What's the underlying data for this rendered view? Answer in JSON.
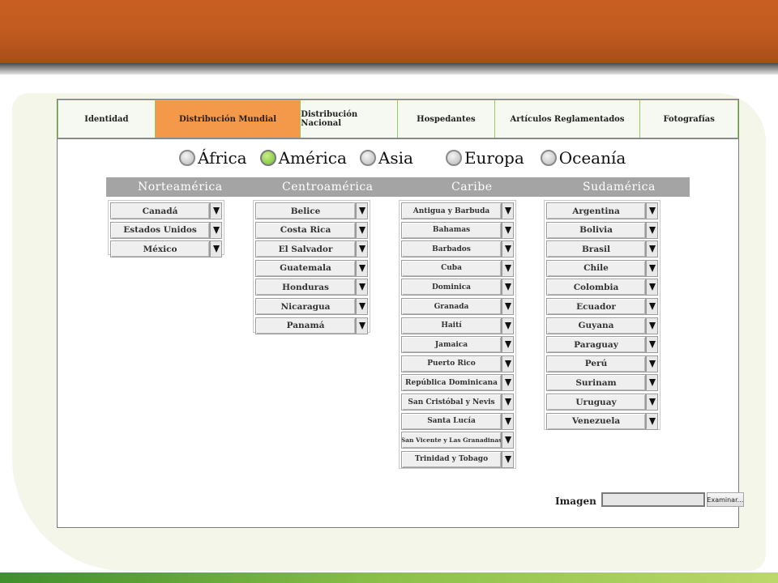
{
  "tabs": [
    {
      "label": "Identidad",
      "active": false
    },
    {
      "label": "Distribución Mundial",
      "active": true
    },
    {
      "label": "Distribución Nacional",
      "active": false
    },
    {
      "label": "Hospedantes",
      "active": false
    },
    {
      "label": "Artículos Reglamentados",
      "active": false
    },
    {
      "label": "Fotografías",
      "active": false
    }
  ],
  "regions": [
    {
      "label": "África",
      "selected": false
    },
    {
      "label": "América",
      "selected": true
    },
    {
      "label": "Asia",
      "selected": false
    },
    {
      "label": "Europa",
      "selected": false
    },
    {
      "label": "Oceanía",
      "selected": false
    }
  ],
  "subregions": [
    "Norteamérica",
    "Centroamérica",
    "Caribe",
    "Sudamérica"
  ],
  "norteamerica": [
    "Canadá",
    "Estados Unidos",
    "México"
  ],
  "centroamerica": [
    "Belice",
    "Costa Rica",
    "El Salvador",
    "Guatemala",
    "Honduras",
    "Nicaragua",
    "Panamá"
  ],
  "caribe": [
    "Antigua y Barbuda",
    "Bahamas",
    "Barbados",
    "Cuba",
    "Dominica",
    "Granada",
    "Haití",
    "Jamaica",
    "Puerto Rico",
    "República Dominicana",
    "San Cristóbal y Nevis",
    "Santa Lucía",
    "San Vicente y Las Granadinas",
    "Trinidad y Tobago"
  ],
  "sudamerica": [
    "Argentina",
    "Bolivia",
    "Brasil",
    "Chile",
    "Colombia",
    "Ecuador",
    "Guyana",
    "Paraguay",
    "Perú",
    "Surinam",
    "Uruguay",
    "Venezuela"
  ],
  "image_field": {
    "label": "Imagen",
    "button": "Examinar..."
  },
  "colors": {
    "banner": "#c95f22",
    "active_tab": "#f4984a",
    "radio_on": "#6fbe2e",
    "subheader": "#a4a4a4",
    "tab_border": "#8fcf5a"
  }
}
